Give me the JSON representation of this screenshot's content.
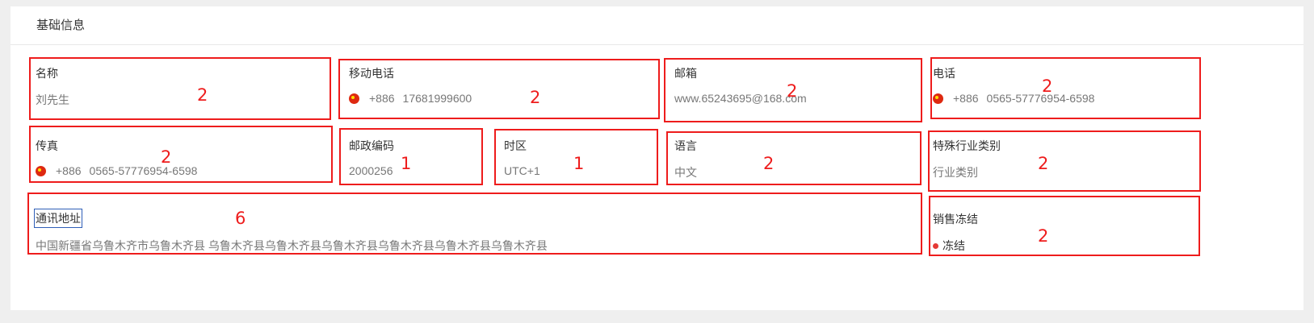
{
  "section": {
    "title": "基础信息"
  },
  "fields": {
    "name": {
      "label": "名称",
      "value": "刘先生",
      "annotation": "2"
    },
    "mobile": {
      "label": "移动电话",
      "country_code": "+886",
      "value": "17681999600",
      "annotation": "2"
    },
    "email": {
      "label": "邮箱",
      "value": "www.65243695@168.com",
      "annotation": "2"
    },
    "phone": {
      "label": "电话",
      "country_code": "+886",
      "value": "0565-57776954-6598",
      "annotation": "2"
    },
    "fax": {
      "label": "传真",
      "country_code": "+886",
      "value": "0565-57776954-6598",
      "annotation": "2"
    },
    "postal": {
      "label": "邮政编码",
      "value": "2000256",
      "annotation": "1"
    },
    "timezone": {
      "label": "时区",
      "value": "UTC+1",
      "annotation": "1"
    },
    "language": {
      "label": "语言",
      "value": "中文",
      "annotation": "2"
    },
    "industry": {
      "label": "特殊行业类别",
      "value": "行业类别",
      "annotation": "2"
    },
    "address": {
      "label": "通讯地址",
      "value": "中国新疆省乌鲁木齐市乌鲁木齐县  乌鲁木齐县乌鲁木齐县乌鲁木齐县乌鲁木齐县乌鲁木齐县乌鲁木齐县",
      "annotation": "6"
    },
    "sales_freeze": {
      "label": "销售冻结",
      "value": "冻结",
      "annotation": "2"
    }
  },
  "colors": {
    "annotation": "#ee1c1c",
    "flag": "#de2910",
    "status_dot": "#e53935"
  },
  "icons": {
    "flag": "china-flag-icon",
    "status": "status-dot-icon"
  }
}
